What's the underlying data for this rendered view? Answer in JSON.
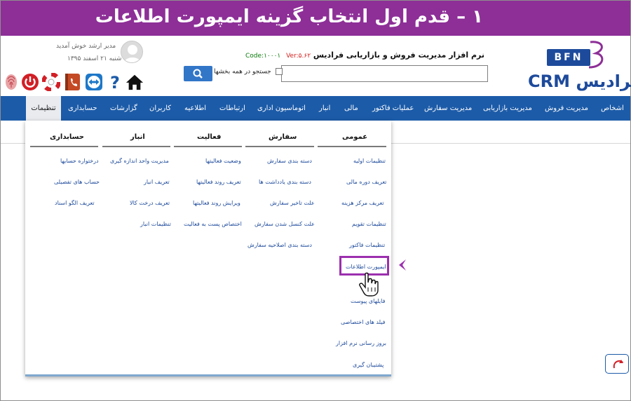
{
  "banner": {
    "title": "۱ – قدم اول انتخاب گزینه ایمپورت اطلاعات"
  },
  "logo": {
    "badge": "BFN",
    "text": "فرادیس CRM"
  },
  "product": {
    "name": "نرم افزار مدیریت فروش و بازاریابی فرادیس",
    "code": "Code:۱۰۰۰۱",
    "version": "Ver:۵.۶۲"
  },
  "search": {
    "checkbox_label": "جستجو در همه بخشها",
    "value": ""
  },
  "user": {
    "greeting": "مدیر ارشد خوش آمدید",
    "date": "شنبه ۲۱ اسفند ۱۳۹۵"
  },
  "toolbar": {
    "icons": [
      "home-icon",
      "help-icon",
      "teamviewer-icon",
      "phonebook-icon",
      "lifebuoy-icon",
      "power-icon",
      "fingerprint-icon"
    ]
  },
  "nav": {
    "items": [
      {
        "label": "اشخاص",
        "icon": "people-icon"
      },
      {
        "label": "مدیریت فروش",
        "icon": "sales-icon"
      },
      {
        "label": "مدیریت بازاریابی",
        "icon": "marketing-icon"
      },
      {
        "label": "مدیریت سفارش",
        "icon": "order-icon"
      },
      {
        "label": "عملیات فاکتور",
        "icon": "invoice-icon"
      },
      {
        "label": "مالی",
        "icon": "finance-icon"
      },
      {
        "label": "انبار",
        "icon": "warehouse-icon"
      },
      {
        "label": "اتوماسیون اداری",
        "icon": "automation-icon"
      },
      {
        "label": "ارتباطات",
        "icon": "communication-icon"
      },
      {
        "label": "اطلاعیه",
        "icon": "notice-icon"
      },
      {
        "label": "کاربران",
        "icon": "users-icon"
      },
      {
        "label": "گزارشات",
        "icon": "reports-icon"
      },
      {
        "label": "حسابداری",
        "icon": "accounting-icon"
      },
      {
        "label": "تنظیمات",
        "icon": "settings-icon",
        "active": true
      }
    ]
  },
  "menu": {
    "columns": [
      {
        "title": "عمومی",
        "links": [
          "تنظیمات اولیه",
          "تعریف دوره مالی",
          "تعریف مرکز هزینه",
          "تنظیمات تقویم",
          "تنظیمات فاکتور",
          "ایمپورت اطلاعات",
          "فایلهای پیوست",
          "فیلد های اختصاصی",
          "بروز رسانی نرم افزار",
          "پشتیبان گیری"
        ]
      },
      {
        "title": "سفارش",
        "links": [
          "دسته بندی سفارش",
          "دسته بندی یادداشت ها",
          "علت تاخیر سفارش",
          "علت کنسل شدن سفارش",
          "دسته بندی اصلاحیه سفارش"
        ]
      },
      {
        "title": "فعالیت",
        "links": [
          "وضعیت فعالیتها",
          "تعریف روند فعالیتها",
          "ویرایش روند فعالیتها",
          "اختصاص پست به فعالیت"
        ]
      },
      {
        "title": "انبار",
        "links": [
          "مدیریت واحد اندازه گیری",
          "تعریف انبار",
          "تعریف درخت کالا",
          "تنظیمات انبار"
        ]
      },
      {
        "title": "حسابداری",
        "links": [
          "درختواره حسابها",
          "حساب های تفصیلی",
          "تعریف الگو اسناد"
        ]
      }
    ],
    "highlighted": "ایمپورت اطلاعات"
  },
  "colors": {
    "banner": "#8d2f97",
    "nav": "#1c5ba8",
    "highlight": "#9b2fae",
    "link": "#1d4a9b"
  }
}
